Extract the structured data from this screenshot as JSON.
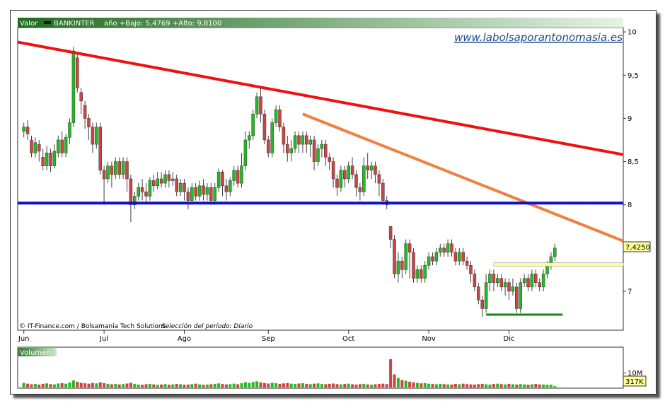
{
  "header": {
    "valor_label": "Valor",
    "ticker": "BANKINTER",
    "range_text": "año +Bajo: 5,4769 +Alto: 9,8100"
  },
  "watermark": "www.labolsaporantonomasia.es",
  "credits": "© IT-Finance.com / Bolsamania Tech Solutions",
  "period_note": "Selección del período: Diario",
  "volume_label": "Volumen",
  "last_price_label": "7,4250",
  "last_volume_label": "317K",
  "colors": {
    "up": "#22bb22",
    "down": "#cc4444",
    "header_start": "#1f6a1f",
    "header_end": "#e4f4e4",
    "resistance_long": "#ee1111",
    "resistance_short": "#f08040",
    "support": "#1111cc",
    "box_yellow": "#ffff99",
    "support_green": "#118811"
  },
  "chart_data": {
    "type": "candlestick",
    "price_axis": {
      "ticks": [
        7,
        7.5,
        8,
        8.5,
        9,
        9.5,
        10
      ],
      "tick_labels": [
        "7",
        "7,5",
        "8",
        "8,5",
        "9",
        "9,5",
        "10"
      ],
      "range": [
        6.55,
        10.05
      ],
      "side": "right"
    },
    "volume_axis": {
      "ticks": [
        10
      ],
      "tick_labels": [
        "10M"
      ],
      "unit": "M"
    },
    "months": [
      "Jun",
      "Jul",
      "Ago",
      "Sep",
      "Oct",
      "Nov",
      "Dic"
    ],
    "month_day_index": [
      0,
      21,
      42,
      64,
      85,
      106,
      127
    ],
    "total_days": 158,
    "last_price": 7.425,
    "last_volume_k": 317,
    "trendlines": [
      {
        "name": "resistance-long",
        "from": {
          "day": -16,
          "price": 10.0
        },
        "to": {
          "day": 157,
          "price": 8.58
        }
      },
      {
        "name": "resistance-short",
        "from": {
          "day": 73,
          "price": 9.05
        },
        "to": {
          "day": 157,
          "price": 7.58
        }
      },
      {
        "name": "support-horizontal",
        "from": {
          "day": -16,
          "price": 8.02
        },
        "to": {
          "day": 157,
          "price": 8.02
        }
      },
      {
        "name": "support-green",
        "from": {
          "day": 121,
          "price": 6.73
        },
        "to": {
          "day": 141,
          "price": 6.73
        }
      }
    ],
    "yellow_box": {
      "from_day": 123,
      "to_day": 157,
      "low": 7.29,
      "high": 7.33
    },
    "candles": [
      [
        8.85,
        8.9,
        8.95,
        8.78
      ],
      [
        8.9,
        8.82,
        8.98,
        8.75
      ],
      [
        8.75,
        8.6,
        8.8,
        8.55
      ],
      [
        8.6,
        8.72,
        8.78,
        8.55
      ],
      [
        8.7,
        8.62,
        8.75,
        8.5
      ],
      [
        8.55,
        8.45,
        8.65,
        8.4
      ],
      [
        8.45,
        8.6,
        8.68,
        8.4
      ],
      [
        8.6,
        8.45,
        8.65,
        8.38
      ],
      [
        8.45,
        8.62,
        8.7,
        8.42
      ],
      [
        8.6,
        8.75,
        8.8,
        8.55
      ],
      [
        8.75,
        8.6,
        8.85,
        8.55
      ],
      [
        8.6,
        8.78,
        8.82,
        8.55
      ],
      [
        8.78,
        8.95,
        9.0,
        8.7
      ],
      [
        8.95,
        9.78,
        9.83,
        8.9
      ],
      [
        9.7,
        9.35,
        9.75,
        9.3
      ],
      [
        9.3,
        9.2,
        9.35,
        9.05
      ],
      [
        9.15,
        9.0,
        9.2,
        8.88
      ],
      [
        9.0,
        8.9,
        9.05,
        8.75
      ],
      [
        8.9,
        8.7,
        8.95,
        8.6
      ],
      [
        8.7,
        8.9,
        8.95,
        8.65
      ],
      [
        8.9,
        8.4,
        8.95,
        8.35
      ],
      [
        8.4,
        8.3,
        8.45,
        8.0
      ],
      [
        8.3,
        8.45,
        8.5,
        8.25
      ],
      [
        8.45,
        8.35,
        8.5,
        8.2
      ],
      [
        8.35,
        8.5,
        8.55,
        8.3
      ],
      [
        8.5,
        8.35,
        8.55,
        8.3
      ],
      [
        8.35,
        8.5,
        8.55,
        8.3
      ],
      [
        8.5,
        8.3,
        8.55,
        8.15
      ],
      [
        8.3,
        8.0,
        8.35,
        7.8
      ],
      [
        8.0,
        8.1,
        8.15,
        7.95
      ],
      [
        8.1,
        8.2,
        8.25,
        8.05
      ],
      [
        8.2,
        8.15,
        8.3,
        8.05
      ],
      [
        8.15,
        8.1,
        8.25,
        8.0
      ],
      [
        8.1,
        8.28,
        8.32,
        8.05
      ],
      [
        8.28,
        8.22,
        8.35,
        8.15
      ],
      [
        8.22,
        8.3,
        8.38,
        8.18
      ],
      [
        8.3,
        8.25,
        8.38,
        8.2
      ],
      [
        8.25,
        8.35,
        8.4,
        8.2
      ],
      [
        8.35,
        8.28,
        8.4,
        8.2
      ],
      [
        8.28,
        8.3,
        8.38,
        8.22
      ],
      [
        8.3,
        8.15,
        8.35,
        8.1
      ],
      [
        8.15,
        8.25,
        8.3,
        8.1
      ],
      [
        8.25,
        8.15,
        8.3,
        8.05
      ],
      [
        8.15,
        8.05,
        8.2,
        7.95
      ],
      [
        8.05,
        8.2,
        8.25,
        8.0
      ],
      [
        8.2,
        8.1,
        8.25,
        8.05
      ],
      [
        8.1,
        8.22,
        8.28,
        8.05
      ],
      [
        8.22,
        8.12,
        8.3,
        8.05
      ],
      [
        8.12,
        8.2,
        8.25,
        8.05
      ],
      [
        8.2,
        8.05,
        8.25,
        8.0
      ],
      [
        8.05,
        8.2,
        8.25,
        8.0
      ],
      [
        8.2,
        8.38,
        8.42,
        8.15
      ],
      [
        8.38,
        8.22,
        8.4,
        8.1
      ],
      [
        8.22,
        8.15,
        8.3,
        8.05
      ],
      [
        8.15,
        8.28,
        8.32,
        8.1
      ],
      [
        8.28,
        8.4,
        8.45,
        8.22
      ],
      [
        8.4,
        8.25,
        8.45,
        8.2
      ],
      [
        8.25,
        8.45,
        8.6,
        8.2
      ],
      [
        8.45,
        8.75,
        8.85,
        8.4
      ],
      [
        8.75,
        8.8,
        8.85,
        8.65
      ],
      [
        8.8,
        9.05,
        9.1,
        8.75
      ],
      [
        9.05,
        9.25,
        9.3,
        9.0
      ],
      [
        9.25,
        9.05,
        9.35,
        8.95
      ],
      [
        9.05,
        8.75,
        9.1,
        8.7
      ],
      [
        8.75,
        8.6,
        8.8,
        8.55
      ],
      [
        8.6,
        8.95,
        9.0,
        8.55
      ],
      [
        8.95,
        9.1,
        9.15,
        8.9
      ],
      [
        9.1,
        8.9,
        9.15,
        8.85
      ],
      [
        8.9,
        8.7,
        8.95,
        8.6
      ],
      [
        8.7,
        8.6,
        8.8,
        8.5
      ],
      [
        8.6,
        8.65,
        8.75,
        8.5
      ],
      [
        8.65,
        8.8,
        8.85,
        8.6
      ],
      [
        8.8,
        8.7,
        8.85,
        8.6
      ],
      [
        8.7,
        8.8,
        8.85,
        8.6
      ],
      [
        8.8,
        8.7,
        8.85,
        8.6
      ],
      [
        8.7,
        8.75,
        8.8,
        8.55
      ],
      [
        8.75,
        8.5,
        8.8,
        8.4
      ],
      [
        8.5,
        8.65,
        8.7,
        8.45
      ],
      [
        8.65,
        8.7,
        8.75,
        8.55
      ],
      [
        8.7,
        8.55,
        8.75,
        8.45
      ],
      [
        8.55,
        8.5,
        8.6,
        8.4
      ],
      [
        8.5,
        8.3,
        8.55,
        8.2
      ],
      [
        8.3,
        8.2,
        8.35,
        8.1
      ],
      [
        8.2,
        8.4,
        8.45,
        8.15
      ],
      [
        8.4,
        8.3,
        8.45,
        8.2
      ],
      [
        8.3,
        8.45,
        8.5,
        8.25
      ],
      [
        8.45,
        8.35,
        8.55,
        8.3
      ],
      [
        8.35,
        8.2,
        8.4,
        8.1
      ],
      [
        8.2,
        8.15,
        8.25,
        8.05
      ],
      [
        8.15,
        8.45,
        8.55,
        8.1
      ],
      [
        8.45,
        8.4,
        8.6,
        8.3
      ],
      [
        8.4,
        8.45,
        8.5,
        8.3
      ],
      [
        8.45,
        8.35,
        8.5,
        8.25
      ],
      [
        8.35,
        8.25,
        8.4,
        8.1
      ],
      [
        8.25,
        8.05,
        8.3,
        8.0
      ],
      [
        8.05,
        8.0,
        8.1,
        7.95
      ],
      [
        7.75,
        7.6,
        7.75,
        7.5
      ],
      [
        7.6,
        7.2,
        7.65,
        7.15
      ],
      [
        7.2,
        7.35,
        7.45,
        7.1
      ],
      [
        7.35,
        7.25,
        7.4,
        7.15
      ],
      [
        7.25,
        7.55,
        7.6,
        7.2
      ],
      [
        7.55,
        7.45,
        7.6,
        7.15
      ],
      [
        7.45,
        7.15,
        7.5,
        7.1
      ],
      [
        7.15,
        7.25,
        7.3,
        7.1
      ],
      [
        7.25,
        7.15,
        7.3,
        7.1
      ],
      [
        7.15,
        7.3,
        7.35,
        7.1
      ],
      [
        7.3,
        7.4,
        7.45,
        7.25
      ],
      [
        7.4,
        7.35,
        7.45,
        7.3
      ],
      [
        7.35,
        7.45,
        7.5,
        7.3
      ],
      [
        7.45,
        7.5,
        7.55,
        7.4
      ],
      [
        7.5,
        7.45,
        7.55,
        7.4
      ],
      [
        7.45,
        7.55,
        7.6,
        7.4
      ],
      [
        7.55,
        7.45,
        7.6,
        7.4
      ],
      [
        7.45,
        7.35,
        7.5,
        7.3
      ],
      [
        7.35,
        7.45,
        7.5,
        7.3
      ],
      [
        7.45,
        7.35,
        7.5,
        7.3
      ],
      [
        7.35,
        7.3,
        7.4,
        7.25
      ],
      [
        7.3,
        7.2,
        7.35,
        7.1
      ],
      [
        7.2,
        7.05,
        7.25,
        7.0
      ],
      [
        7.05,
        6.9,
        7.1,
        6.85
      ],
      [
        6.9,
        6.8,
        6.95,
        6.7
      ],
      [
        6.8,
        7.1,
        7.2,
        6.75
      ],
      [
        7.1,
        7.2,
        7.25,
        7.0
      ],
      [
        7.2,
        7.1,
        7.25,
        7.0
      ],
      [
        7.1,
        7.15,
        7.2,
        7.05
      ],
      [
        7.15,
        7.05,
        7.2,
        7.0
      ],
      [
        7.05,
        7.1,
        7.15,
        6.95
      ],
      [
        7.1,
        7.0,
        7.15,
        6.9
      ],
      [
        7.0,
        7.05,
        7.15,
        6.95
      ],
      [
        7.05,
        6.8,
        7.1,
        6.75
      ],
      [
        6.8,
        7.1,
        7.15,
        6.75
      ],
      [
        7.1,
        7.15,
        7.2,
        7.05
      ],
      [
        7.15,
        7.05,
        7.2,
        7.0
      ],
      [
        7.05,
        7.2,
        7.25,
        7.0
      ],
      [
        7.2,
        7.1,
        7.25,
        7.05
      ],
      [
        7.1,
        7.05,
        7.15,
        7.0
      ],
      [
        7.05,
        7.2,
        7.25,
        7.0
      ],
      [
        7.2,
        7.3,
        7.35,
        7.15
      ],
      [
        7.3,
        7.4,
        7.45,
        7.25
      ],
      [
        7.4,
        7.5,
        7.55,
        7.35
      ]
    ],
    "volumes": [
      3.1,
      2.6,
      2.2,
      2.4,
      2.0,
      2.5,
      2.8,
      2.3,
      2.1,
      2.7,
      3.0,
      2.6,
      3.4,
      4.8,
      3.9,
      3.2,
      2.9,
      2.6,
      3.1,
      2.8,
      3.5,
      3.0,
      2.5,
      2.2,
      2.4,
      2.1,
      2.3,
      2.7,
      3.2,
      2.4,
      2.0,
      1.9,
      2.2,
      2.5,
      2.1,
      1.8,
      2.0,
      2.3,
      1.9,
      2.1,
      2.4,
      2.2,
      1.9,
      2.0,
      2.3,
      2.6,
      2.1,
      1.8,
      2.0,
      2.2,
      2.5,
      2.8,
      2.4,
      2.1,
      2.3,
      2.6,
      2.2,
      2.9,
      3.6,
      3.1,
      3.8,
      4.2,
      3.5,
      3.0,
      2.7,
      3.2,
      2.9,
      2.5,
      2.8,
      3.0,
      2.6,
      2.4,
      2.7,
      2.9,
      2.5,
      2.3,
      2.6,
      2.8,
      2.4,
      2.2,
      2.5,
      2.7,
      2.3,
      2.1,
      2.4,
      2.6,
      2.2,
      2.0,
      2.3,
      2.5,
      2.1,
      1.9,
      2.2,
      2.4,
      2.6,
      2.3,
      19.5,
      9.0,
      6.5,
      5.2,
      4.6,
      4.0,
      3.5,
      3.1,
      2.8,
      3.0,
      2.6,
      2.4,
      2.2,
      2.5,
      2.3,
      2.1,
      2.0,
      2.4,
      2.2,
      2.6,
      2.3,
      2.1,
      2.0,
      2.3,
      2.5,
      2.2,
      2.0,
      2.4,
      2.6,
      2.3,
      2.1,
      2.5,
      2.2,
      2.0,
      2.3,
      2.1,
      1.9,
      2.2,
      2.4,
      2.1,
      2.0,
      1.8,
      1.9,
      0.9
    ]
  }
}
